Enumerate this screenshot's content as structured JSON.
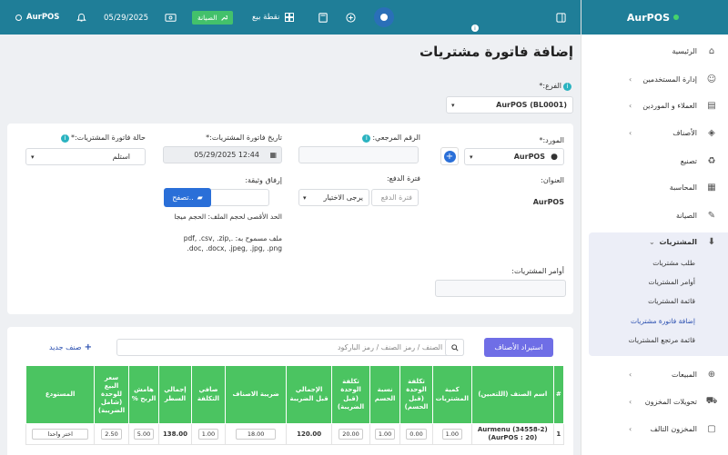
{
  "brand": {
    "name": "AurPOS",
    "accent": "#1f7e98"
  },
  "topbar": {
    "app_name": "AurPOS",
    "date": "05/29/2025",
    "maintenance_label": "الصيانة",
    "pos_label": "نقطة بيع",
    "icons": [
      "bell-icon",
      "money-icon",
      "wrench-icon",
      "grid-icon",
      "calculator-icon",
      "plus-circle-icon",
      "info-icon",
      "panel-toggle-icon"
    ]
  },
  "sidebar": {
    "items": [
      {
        "label": "الرئيسية",
        "icon": "home-icon"
      },
      {
        "label": "إدارة المستخدمين",
        "icon": "users-icon"
      },
      {
        "label": "العملاء و الموردين",
        "icon": "address-book-icon"
      },
      {
        "label": "الأصناف",
        "icon": "box-icon"
      },
      {
        "label": "تصنيع",
        "icon": "recycle-icon"
      },
      {
        "label": "المحاسبة",
        "icon": "calculator-icon"
      },
      {
        "label": "الصيانة",
        "icon": "wrench-icon"
      },
      {
        "label": "المشتريات",
        "icon": "download-icon"
      },
      {
        "label": "المبيعات",
        "icon": "arrow-circle-up-icon"
      },
      {
        "label": "تحويلات المخزون",
        "icon": "truck-icon"
      },
      {
        "label": "المخزون التالف",
        "icon": "trash-icon"
      }
    ],
    "purchases_sub": [
      "طلب مشتريات",
      "أوامر المشتريات",
      "قائمة المشتريات",
      "إضافة فاتورة مشتريات",
      "قائمة مرتجع المشتريات"
    ]
  },
  "page": {
    "title": "إضافة فاتورة مشتريات",
    "branch_label": "الفرع:*",
    "branch_value": "AurPOS (BL0001)",
    "supplier_label": "المورد:*",
    "supplier_value": "AurPOS",
    "ref_label": "الرقم المرجعي:",
    "date_label": "تاريخ فاتورة المشتريات:*",
    "date_value": "05/29/2025 12:44",
    "status_label": "حالة فاتورة المشتريات:*",
    "status_value": "استلم",
    "address_label": "العنوان:",
    "address_value": "AurPOS",
    "pay_term_label": "فترة الدفع:",
    "pay_term_placeholder": "فترة الدفع",
    "pay_term_select": "يرجى الاختيار",
    "attach_label": "إرفاق وثيقة:",
    "browse_label": "تصفح..",
    "max_size_note": "الحد الأقصى لحجم الملف: الحجم ميجا",
    "allowed_files_note": "ملف مسموح به: .pdf, .csv, .zip, .doc, .docx, .jpeg, .jpg, .png",
    "purchase_orders_label": "أوامر المشتريات:"
  },
  "products": {
    "import_label": "استيراد الأصناف",
    "search_placeholder": "اسم الصنف / رمز الصنف / رمز الباركود",
    "new_product_label": "صنف جديد",
    "headers": [
      "#",
      "اسم الصنف (اللتعبين)",
      "كمية المشتريات",
      "تكلفة الوحدة (قبل الحسم)",
      "نسبة الحسم",
      "تكلفة الوحدة (قبل الضريبة)",
      "الإجمالي قبل الضريبة",
      "ضريبة الاصناف",
      "صافي التكلفة",
      "إجمالي السطر",
      "هامش الربح %",
      "سعر البيع للوحدة (شامل الضريبة)",
      "المستودع"
    ],
    "rows": [
      {
        "index": "1",
        "name": "Aurmenu (34558-2)",
        "sku": "(AurPOS : 20)",
        "qty": "1.00",
        "unit_cost": "0.00",
        "discount": "1.00",
        "cost_before_tax": "20.00",
        "total_before_tax": "120.00",
        "tax": "18.00",
        "net_cost": "1.00",
        "line_total": "138.00",
        "margin": "5.00",
        "sell_price": "2.50",
        "warehouse": "اختر واحدا"
      }
    ]
  }
}
